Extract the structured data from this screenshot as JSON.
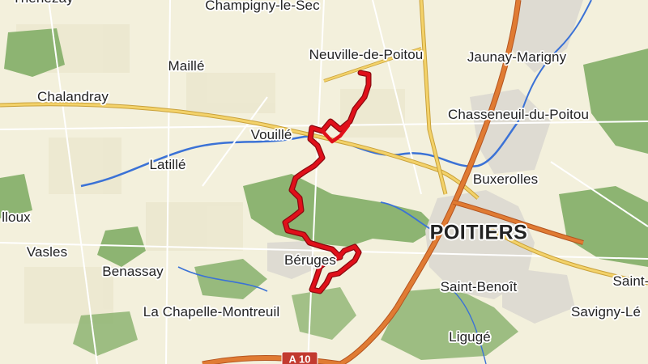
{
  "map": {
    "colors": {
      "land": "#f3f0dc",
      "forest": "#7aa562",
      "urban": "#e4e1d8",
      "river": "#3b72d6",
      "motorway": "#d96a2b",
      "primary_road": "#f3c84a",
      "route_track": "#e0101a"
    },
    "places": [
      {
        "id": "place-champigny-le-sec",
        "name": "Champigny-le-Sec",
        "size": "normal"
      },
      {
        "id": "place-thenezay",
        "name": "Thénezay",
        "size": "normal"
      },
      {
        "id": "place-maille",
        "name": "Maillé",
        "size": "normal"
      },
      {
        "id": "place-neuville-de-poitou",
        "name": "Neuville-de-Poitou",
        "size": "normal"
      },
      {
        "id": "place-jaunay-marigny",
        "name": "Jaunay-Marigny",
        "size": "normal"
      },
      {
        "id": "place-chalandray",
        "name": "Chalandray",
        "size": "normal"
      },
      {
        "id": "place-chasseneuil-du-poitou",
        "name": "Chasseneuil-du-Poitou",
        "size": "normal"
      },
      {
        "id": "place-vouille",
        "name": "Vouillé",
        "size": "normal"
      },
      {
        "id": "place-latille",
        "name": "Latillé",
        "size": "normal"
      },
      {
        "id": "place-buxerolles",
        "name": "Buxerolles",
        "size": "normal"
      },
      {
        "id": "place-ayron",
        "name": "lloux",
        "size": "normal"
      },
      {
        "id": "place-poitiers",
        "name": "POITIERS",
        "size": "big"
      },
      {
        "id": "place-vasles",
        "name": "Vasles",
        "size": "normal"
      },
      {
        "id": "place-beruges",
        "name": "Béruges",
        "size": "normal"
      },
      {
        "id": "place-benassay",
        "name": "Benassay",
        "size": "normal"
      },
      {
        "id": "place-saint-benoit",
        "name": "Saint-Benoît",
        "size": "normal"
      },
      {
        "id": "place-saint-right",
        "name": "Saint-",
        "size": "normal"
      },
      {
        "id": "place-la-chapelle-montreuil",
        "name": "La Chapelle-Montreuil",
        "size": "normal"
      },
      {
        "id": "place-savigny",
        "name": "Savigny-Lé",
        "size": "normal"
      },
      {
        "id": "place-liguge",
        "name": "Ligugé",
        "size": "normal"
      }
    ],
    "road_shields": [
      {
        "id": "shield-a10",
        "label": "A 10"
      }
    ],
    "route": {
      "type": "hiking-track",
      "start_near": "Neuville-de-Poitou",
      "end_near": "Béruges"
    }
  }
}
